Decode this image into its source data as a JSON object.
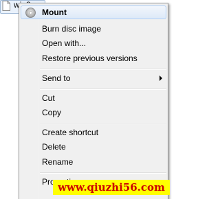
{
  "file": {
    "name": "win8"
  },
  "menu": {
    "items": [
      {
        "label": "Mount",
        "icon": "disc-icon"
      },
      {
        "label": "Burn disc image"
      },
      {
        "label": "Open with..."
      },
      {
        "label": "Restore previous versions"
      },
      {
        "label": "Send to",
        "icon": "submenu-arrow-icon"
      },
      {
        "label": "Cut"
      },
      {
        "label": "Copy"
      },
      {
        "label": "Create shortcut"
      },
      {
        "label": "Delete"
      },
      {
        "label": "Rename"
      },
      {
        "label": "Properties"
      }
    ]
  },
  "watermark": {
    "text": "www.qiuzhi56.com"
  },
  "colors": {
    "menu_background": "#f0f0f0",
    "highlight": "#dde9f8",
    "watermark_background": "#ffff00",
    "watermark_text": "#cc0000"
  }
}
